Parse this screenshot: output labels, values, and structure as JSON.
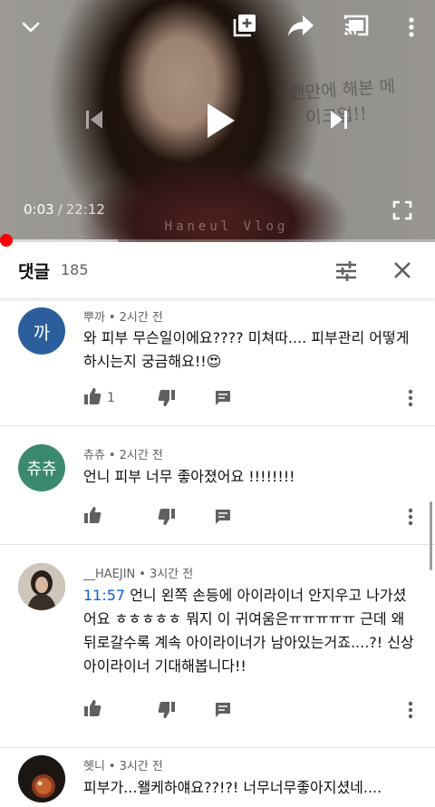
{
  "player": {
    "overlay_text": "오랜만에 해본 메이크업!!",
    "watermark": "Haneul Vlog",
    "current_time": "0:03",
    "separator": "/",
    "duration": "22:12",
    "progress_fraction": 0.002,
    "buffered_fraction": 0.27,
    "accent_color": "#ff0000"
  },
  "comments_header": {
    "title": "댓글",
    "count": "185"
  },
  "comments": [
    {
      "author": "뿌까",
      "time": "2시간 전",
      "avatar_text": "까",
      "avatar_color": "#2b5e9c",
      "text": "와 피부 무슨일이에요???? 미쳐따.... 피부관리 어떻게 하시는지 궁금해요!!😍",
      "likes": "1"
    },
    {
      "author": "츄츄",
      "time": "2시간 전",
      "avatar_text": "츄츄",
      "avatar_color": "#3b8a6e",
      "text": "언니 피부 너무 좋아졌어요 !!!!!!!!",
      "likes": ""
    },
    {
      "author": "__HAEJIN",
      "time": "3시간 전",
      "avatar_text": "",
      "avatar_color": "#6b5a4e",
      "timestamp_link": "11:57",
      "text": " 언니 왼쪽 손등에 아이라이너 안지우고 나가셨어요 ㅎㅎㅎㅎㅎ 뭐지 이 귀여움은ㅠㅠㅠㅠㅠ 근데 왜 뒤로갈수록 계속 아이라이너가 남아있는거죠....?! 신상 아이라이너 기대해봅니다!!",
      "likes": ""
    },
    {
      "author": "혯니",
      "time": "3시간 전",
      "avatar_text": "",
      "avatar_color": "#2a1e16",
      "text": "피부가...왤케하얘요??!?! 너무너무좋아지셨네....",
      "likes": ""
    }
  ]
}
